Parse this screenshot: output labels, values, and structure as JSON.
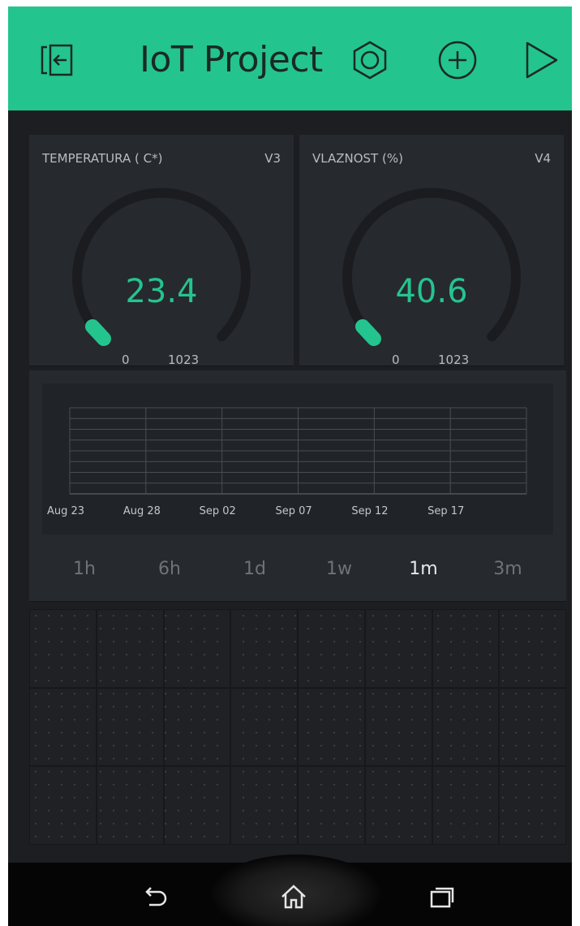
{
  "header": {
    "title": "IoT Project",
    "icons": [
      "exit-icon",
      "settings-nut-icon",
      "add-icon",
      "play-icon"
    ]
  },
  "colors": {
    "accent": "#24c48e",
    "background": "#1c1e22",
    "card": "#26292e",
    "text_muted": "#b9bcc0"
  },
  "gauges": [
    {
      "label": "TEMPERATURA ( C*)",
      "pin": "V3",
      "value": "23.4",
      "min": "0",
      "max": "1023"
    },
    {
      "label": "VLAZNOST (%)",
      "pin": "V4",
      "value": "40.6",
      "min": "0",
      "max": "1023"
    }
  ],
  "chart_data": {
    "type": "line",
    "x_ticks": [
      "Aug 23",
      "Aug 28",
      "Sep 02",
      "Sep 07",
      "Sep 12",
      "Sep 17"
    ],
    "series": [],
    "grid": true
  },
  "time_ranges": {
    "items": [
      "1h",
      "6h",
      "1d",
      "1w",
      "1m",
      "3m"
    ],
    "selected": "1m"
  },
  "navbar": {
    "icons": [
      "back-icon",
      "home-icon",
      "recent-apps-icon"
    ]
  }
}
